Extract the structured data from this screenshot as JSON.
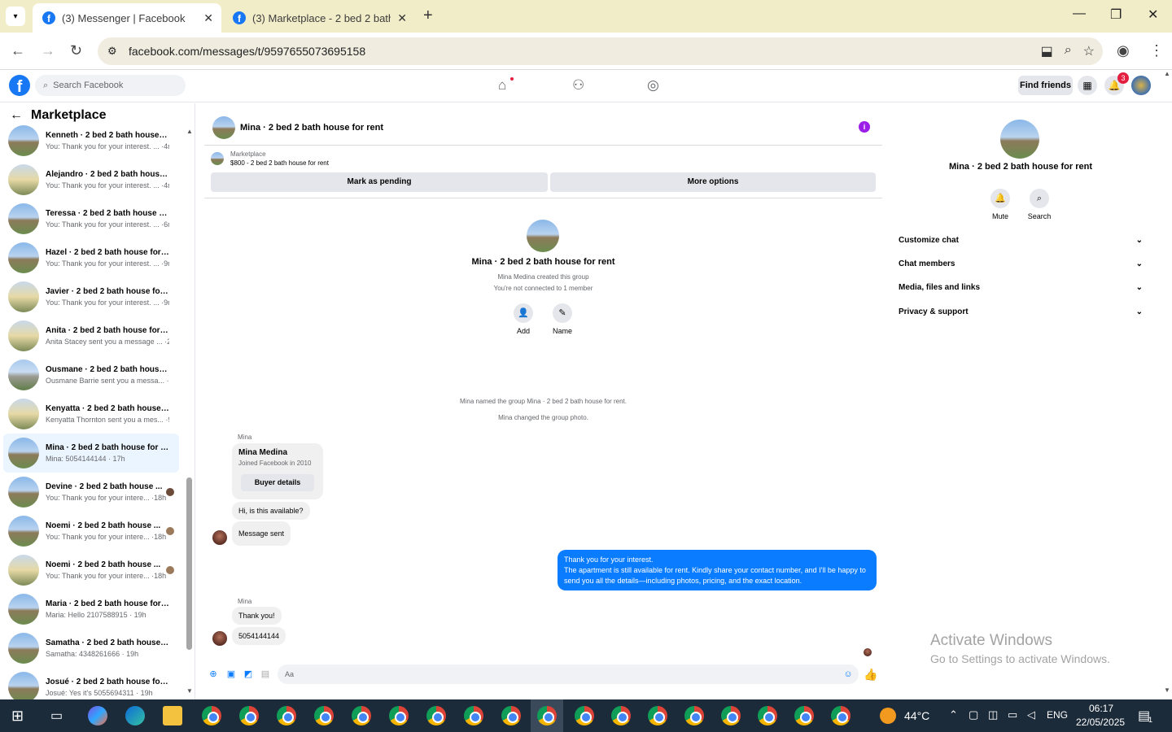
{
  "browser": {
    "tabs": [
      {
        "title": "(3) Messenger | Facebook"
      },
      {
        "title": "(3) Marketplace - 2 bed 2 bath h"
      }
    ],
    "url": "facebook.com/messages/t/9597655073695158",
    "tab_dropdown_icon": "chevron-down-icon",
    "new_tab_symbol": "+"
  },
  "fb": {
    "logo": "f",
    "search_placeholder": "Search Facebook",
    "find_friends": "Find friends",
    "notification_count": "3"
  },
  "sidebar": {
    "title": "Marketplace",
    "conversations": [
      {
        "name": "Kenneth · 2 bed 2 bath house f...",
        "preview": "You: Thank you for your interest. ... ·4m"
      },
      {
        "name": "Alejandro · 2 bed 2 bath house ...",
        "preview": "You: Thank you for your interest. ... ·4m"
      },
      {
        "name": "Teressa · 2 bed 2 bath house fo...",
        "preview": "You: Thank you for your interest. ... ·6m"
      },
      {
        "name": "Hazel · 2 bed 2 bath house for ...",
        "preview": "You: Thank you for your interest. ... ·9m"
      },
      {
        "name": "Javier · 2 bed 2 bath house for ...",
        "preview": "You: Thank you for your interest. ... ·9m"
      },
      {
        "name": "Anita · 2 bed 2 bath house for r...",
        "preview": "Anita Stacey sent you a message ... ·2h"
      },
      {
        "name": "Ousmane · 2 bed 2 bath house ...",
        "preview": "Ousmane Barrie sent you a messa... ·7h"
      },
      {
        "name": "Kenyatta · 2 bed 2 bath house f...",
        "preview": "Kenyatta Thornton sent you a mes... ·9h"
      },
      {
        "name": "Mina · 2 bed 2 bath house for r...",
        "preview": "Mina: 5054144144 · 17h"
      },
      {
        "name": "Devine · 2 bed 2 bath house ...",
        "preview": "You: Thank you for your intere... ·18h"
      },
      {
        "name": "Noemi · 2 bed 2 bath house ...",
        "preview": "You: Thank you for your intere... ·18h"
      },
      {
        "name": "Noemi · 2 bed 2 bath house ...",
        "preview": "You: Thank you for your intere... ·18h"
      },
      {
        "name": "Maria · 2 bed 2 bath house for ...",
        "preview": "Maria: Hello 2107588915 · 19h"
      },
      {
        "name": "Samatha · 2 bed 2 bath house f...",
        "preview": "Samatha: 4348261666 · 19h"
      },
      {
        "name": "Josué · 2 bed 2 bath house for ...",
        "preview": "Josué: Yes it's 5055694311 · 19h"
      }
    ]
  },
  "chat": {
    "title": "Mina · 2 bed 2 bath house for rent",
    "marketplace_label": "Marketplace",
    "listing": "$800 - 2 bed 2 bath house for rent",
    "mark_pending": "Mark as pending",
    "more_options": "More options",
    "group_name": "Mina · 2 bed 2 bath house for rent",
    "created_by": "Mina Medina created this group",
    "not_connected": "You're not connected to 1 member",
    "add_label": "Add",
    "name_label": "Name",
    "sys_named": "Mina named the group Mina · 2 bed 2 bath house for rent.",
    "sys_photo": "Mina changed the group photo.",
    "sender1": "Mina",
    "card_name": "Mina Medina",
    "card_joined": "Joined Facebook in 2010",
    "buyer_details": "Buyer details",
    "msg_available": "Hi, is this available?",
    "msg_sent": "Message sent",
    "my_msg_line1": "Thank you for your interest.",
    "my_msg_line2": "The apartment is still available for rent. Kindly share your contact number, and I'll be happy to send you all the details—including photos, pricing, and the exact location.",
    "sender2": "Mina",
    "msg_thanks": "Thank you!",
    "msg_number": "5054144144",
    "input_placeholder": "Aa"
  },
  "info_panel": {
    "name": "Mina · 2 bed 2 bath house for rent",
    "mute": "Mute",
    "search": "Search",
    "sections": [
      "Customize chat",
      "Chat members",
      "Media, files and links",
      "Privacy & support"
    ]
  },
  "watermark": {
    "line1": "Activate Windows",
    "line2": "Go to Settings to activate Windows."
  },
  "taskbar": {
    "temperature": "44°C",
    "lang": "ENG",
    "time": "06:17",
    "date": "22/05/2025",
    "notif_count": "1"
  }
}
